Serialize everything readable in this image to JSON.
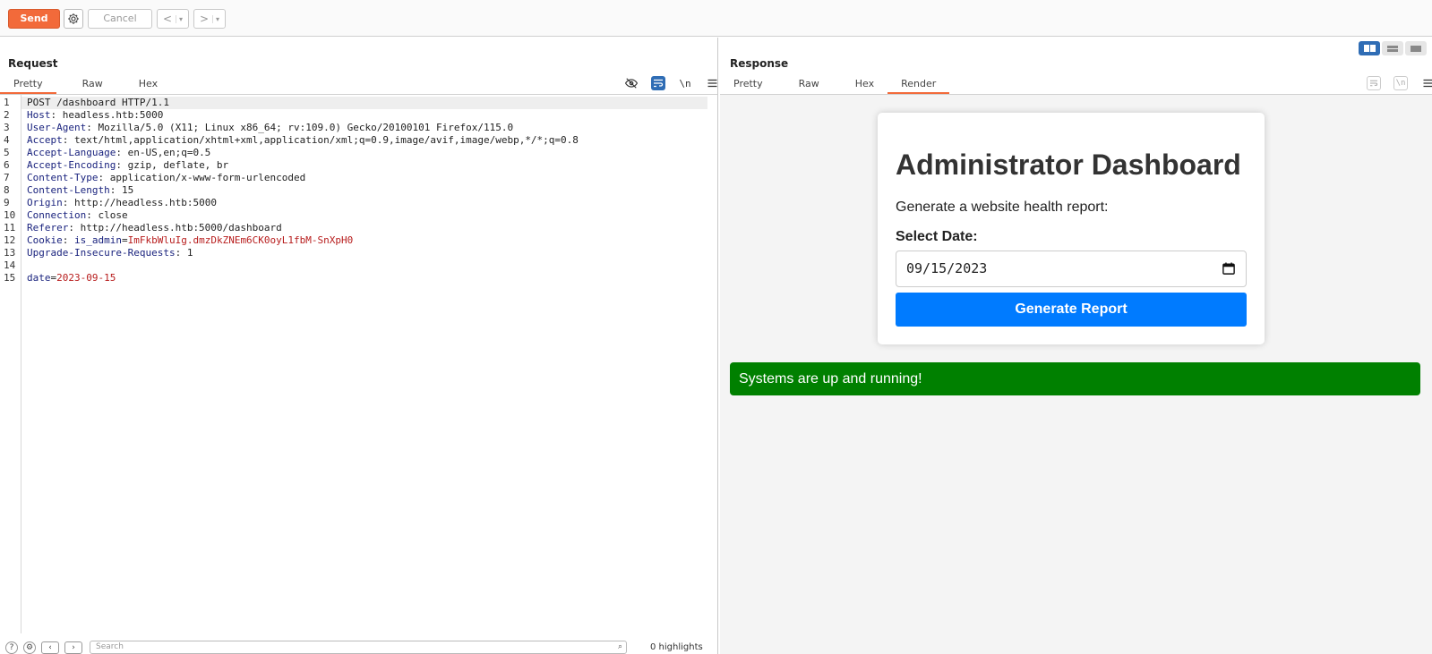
{
  "toolbar": {
    "send_label": "Send",
    "cancel_label": "Cancel",
    "back_label": "<",
    "forward_label": ">",
    "dropdown_glyph": "▾"
  },
  "request": {
    "title": "Request",
    "tabs": [
      "Pretty",
      "Raw",
      "Hex"
    ],
    "active_tab": "Pretty",
    "tool_icons": [
      "eye-off-icon",
      "wrap-icon",
      "newline-icon",
      "menu-icon"
    ],
    "newline_label": "\\n",
    "lines": [
      {
        "n": "1",
        "kind": "plain",
        "text": "POST /dashboard HTTP/1.1"
      },
      {
        "n": "2",
        "kind": "header",
        "key": "Host",
        "value": "headless.htb:5000"
      },
      {
        "n": "3",
        "kind": "header",
        "key": "User-Agent",
        "value": "Mozilla/5.0 (X11; Linux x86_64; rv:109.0) Gecko/20100101 Firefox/115.0"
      },
      {
        "n": "4",
        "kind": "header",
        "key": "Accept",
        "value": "text/html,application/xhtml+xml,application/xml;q=0.9,image/avif,image/webp,*/*;q=0.8"
      },
      {
        "n": "5",
        "kind": "header",
        "key": "Accept-Language",
        "value": "en-US,en;q=0.5"
      },
      {
        "n": "6",
        "kind": "header",
        "key": "Accept-Encoding",
        "value": "gzip, deflate, br"
      },
      {
        "n": "7",
        "kind": "header",
        "key": "Content-Type",
        "value": "application/x-www-form-urlencoded"
      },
      {
        "n": "8",
        "kind": "header",
        "key": "Content-Length",
        "value": "15"
      },
      {
        "n": "9",
        "kind": "header",
        "key": "Origin",
        "value": "http://headless.htb:5000"
      },
      {
        "n": "10",
        "kind": "header",
        "key": "Connection",
        "value": "close"
      },
      {
        "n": "11",
        "kind": "header",
        "key": "Referer",
        "value": "http://headless.htb:5000/dashboard"
      },
      {
        "n": "12",
        "kind": "cookie",
        "key": "Cookie",
        "ckey": "is_admin",
        "cval": "ImFkbWluIg.dmzDkZNEm6CK0oyL1fbM-SnXpH0"
      },
      {
        "n": "13",
        "kind": "header",
        "key": "Upgrade-Insecure-Requests",
        "value": "1"
      },
      {
        "n": "14",
        "kind": "blank"
      },
      {
        "n": "15",
        "kind": "param",
        "ckey": "date",
        "cval": "2023-09-15"
      }
    ],
    "search_placeholder": "Search",
    "highlights_text": "0 highlights"
  },
  "response": {
    "title": "Response",
    "tabs": [
      "Pretty",
      "Raw",
      "Hex",
      "Render"
    ],
    "active_tab": "Render",
    "newline_label": "\\n",
    "render": {
      "heading": "Administrator Dashboard",
      "subtitle": "Generate a website health report:",
      "date_label": "Select Date:",
      "date_value": "09/15/2023",
      "button_label": "Generate Report",
      "status_message": "Systems are up and running!"
    }
  },
  "colors": {
    "accent": "#f26a3a",
    "button_blue": "#007bff",
    "status_green": "#008000",
    "header_key": "#1a237e",
    "cookie_value": "#b71c1c",
    "view_toggle_active": "#2f6db5"
  }
}
